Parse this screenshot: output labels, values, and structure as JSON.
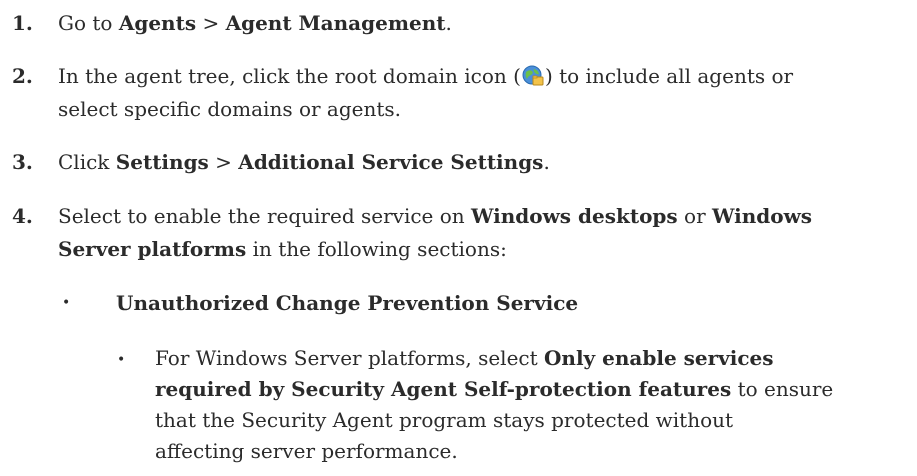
{
  "steps": [
    {
      "number": "1.",
      "go_to": "Go to",
      "agents": "Agents",
      "sep": ">",
      "agent_management": "Agent Management",
      "period": "."
    },
    {
      "number": "2.",
      "before_icon": "In the agent tree, click the root domain icon (",
      "icon": "root-domain-icon",
      "after_icon_line1": ") to include all agents or",
      "line2": "select specific domains or agents."
    },
    {
      "number": "3.",
      "click": "Click",
      "settings": "Settings",
      "sep": ">",
      "additional": "Additional Service Settings",
      "period": "."
    },
    {
      "number": "4.",
      "select_text": "Select to enable the required service on",
      "windows_desktops": "Windows desktops",
      "or": "or",
      "windows": "Windows",
      "server_platforms": "Server platforms",
      "in_sections": "in the following sections:"
    }
  ],
  "bullet": {
    "title": "Unauthorized Change Prevention Service"
  },
  "sub_bullet": {
    "prefix": "For Windows Server platforms, select",
    "bold1": "Only enable services",
    "bold2": "required by Security Agent Self-protection features",
    "suffix1": "to ensure",
    "line3": "that the Security Agent program stays protected without",
    "line4": "affecting server performance."
  },
  "colors": {
    "text": "#2b2b2b",
    "icon_globe": "#4a8fd8",
    "icon_folder": "#f3c34a"
  }
}
